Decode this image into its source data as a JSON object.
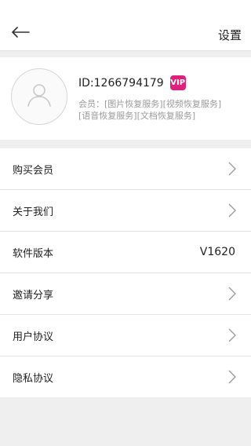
{
  "header": {
    "title": "设置",
    "back_icon": "arrow-left-icon"
  },
  "profile": {
    "avatar_icon": "user-avatar-icon",
    "user_id": "ID:1266794179",
    "vip_label": "VIP",
    "vip_color": "#e0207a",
    "member_line1": "会员：[图片恢复服务][视频恢复服务]",
    "member_line2": "[语音恢复服务][文档恢复服务]"
  },
  "menu": {
    "items": [
      {
        "label": "购买会员",
        "icon": "chevron-right-icon"
      },
      {
        "label": "关于我们",
        "icon": "chevron-right-icon"
      },
      {
        "label": "软件版本",
        "value": "V1620"
      },
      {
        "label": "邀请分享",
        "icon": "chevron-right-icon"
      },
      {
        "label": "用户协议",
        "icon": "chevron-right-icon"
      },
      {
        "label": "隐私协议",
        "icon": "chevron-right-icon"
      }
    ]
  }
}
